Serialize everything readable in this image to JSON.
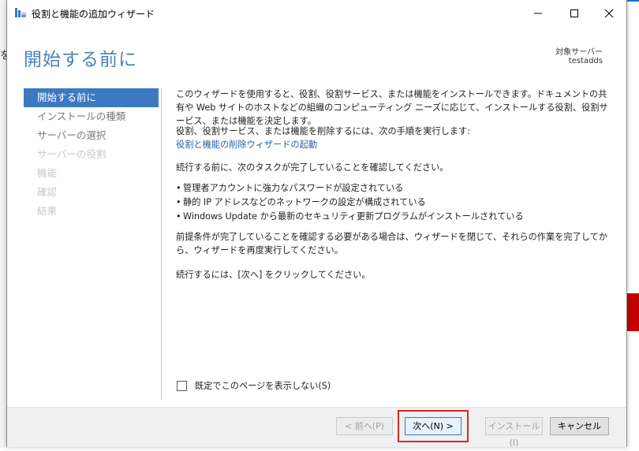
{
  "window": {
    "title": "役割と機能の追加ウィザード"
  },
  "header": {
    "title": "開始する前に",
    "target_label": "対象サーバー",
    "target_name": "testadds"
  },
  "nav": {
    "items": [
      {
        "label": "開始する前に",
        "state": "active"
      },
      {
        "label": "インストールの種類",
        "state": "enabled"
      },
      {
        "label": "サーバーの選択",
        "state": "enabled"
      },
      {
        "label": "サーバーの役割",
        "state": "disabled"
      },
      {
        "label": "機能",
        "state": "disabled"
      },
      {
        "label": "確認",
        "state": "disabled"
      },
      {
        "label": "結果",
        "state": "disabled"
      }
    ]
  },
  "content": {
    "p1": "このウィザードを使用すると、役割、役割サービス、または機能をインストールできます。ドキュメントの共有や Web サイトのホストなどの組織のコンピューティング ニーズに応じて、インストールする役割、役割サービス、または機能を決定します。",
    "p2": "役割、役割サービス、または機能を削除するには、次の手順を実行します:",
    "link": "役割と機能の削除ウィザードの起動",
    "p3": "続行する前に、次のタスクが完了していることを確認してください。",
    "bullets": [
      "管理者アカウントに強力なパスワードが設定されている",
      "静的 IP アドレスなどのネットワークの設定が構成されている",
      "Windows Update から最新のセキュリティ更新プログラムがインストールされている"
    ],
    "p4": "前提条件が完了していることを確認する必要がある場合は、ウィザードを閉じて、それらの作業を完了してから、ウィザードを再度実行してください。",
    "p5": "続行するには、[次へ] をクリックしてください。",
    "checkbox_label": "既定でこのページを表示しない(S)",
    "checkbox_checked": false
  },
  "footer": {
    "prev": "< 前へ(P)",
    "next": "次へ(N) >",
    "install": "インストール(I)",
    "cancel": "キャンセル"
  },
  "background": {
    "left_char": "を"
  },
  "colors": {
    "accent": "#3c79c2",
    "title": "#4d82b8",
    "link": "#2563a8",
    "highlight": "#d22b2b"
  }
}
